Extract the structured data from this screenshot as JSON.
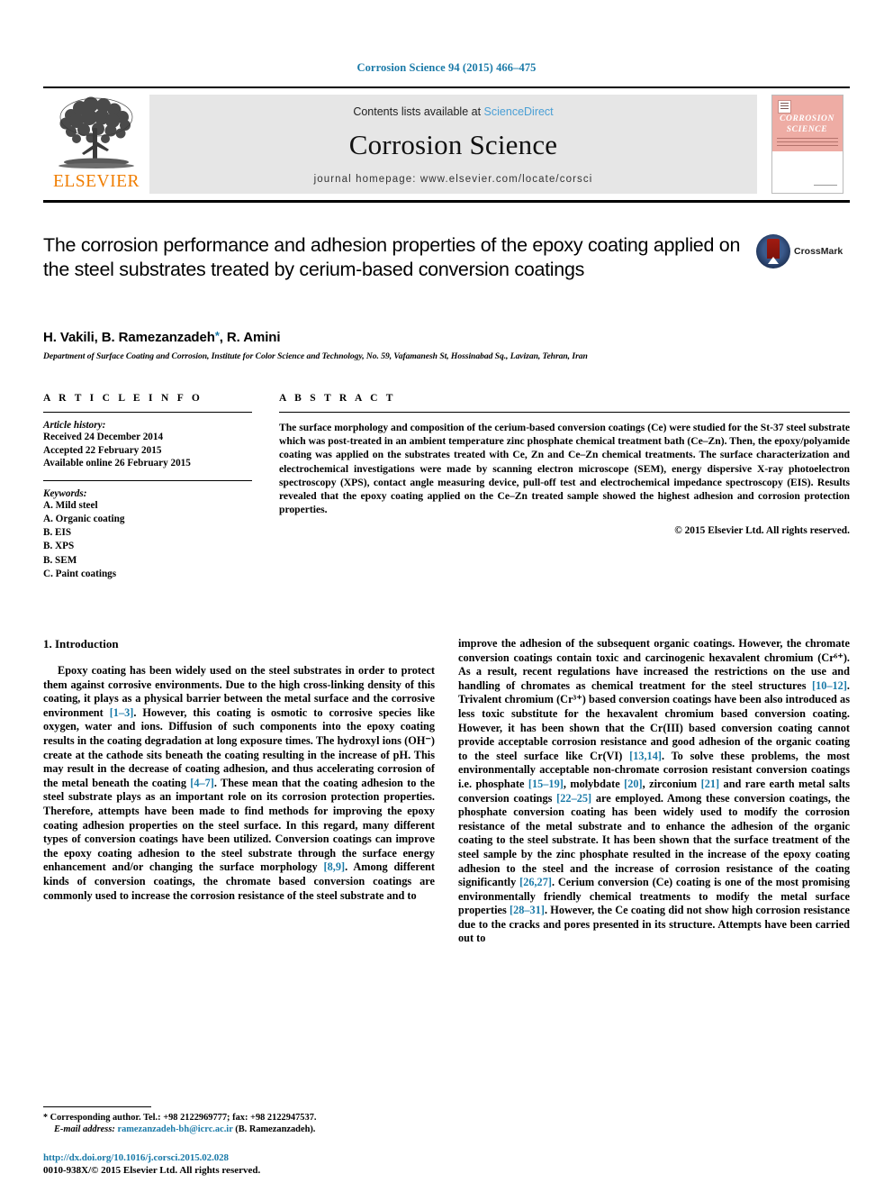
{
  "running_head": "Corrosion Science 94 (2015) 466–475",
  "masthead": {
    "publisher_name": "ELSEVIER",
    "contents_prefix": "Contents lists available at",
    "sciencedirect": "ScienceDirect",
    "journal_name": "Corrosion Science",
    "homepage": "journal homepage: www.elsevier.com/locate/corsci",
    "cover": {
      "line1": "CORROSION",
      "line2": "SCIENCE"
    }
  },
  "article": {
    "title": "The corrosion performance and adhesion properties of the epoxy coating applied on the steel substrates treated by cerium-based conversion coatings",
    "crossmark_label": "CrossMark",
    "authors_pre": "H. Vakili, B. Ramezanzadeh",
    "authors_star": "*",
    "authors_post": ", R. Amini",
    "affiliation": "Department of Surface Coating and Corrosion, Institute for Color Science and Technology, No. 59, Vafamanesh St, Hossinabad Sq., Lavizan, Tehran, Iran"
  },
  "article_info": {
    "heading": "A R T I C L E   I N F O",
    "history_label": "Article history:",
    "history": [
      "Received 24 December 2014",
      "Accepted 22 February 2015",
      "Available online 26 February 2015"
    ],
    "keywords_label": "Keywords:",
    "keywords": [
      "A. Mild steel",
      "A. Organic coating",
      "B. EIS",
      "B. XPS",
      "B. SEM",
      "C. Paint coatings"
    ]
  },
  "abstract": {
    "heading": "A B S T R A C T",
    "text": "The surface morphology and composition of the cerium-based conversion coatings (Ce) were studied for the St-37 steel substrate which was post-treated in an ambient temperature zinc phosphate chemical treatment bath (Ce–Zn). Then, the epoxy/polyamide coating was applied on the substrates treated with Ce, Zn and Ce–Zn chemical treatments. The surface characterization and electrochemical investigations were made by scanning electron microscope (SEM), energy dispersive X-ray photoelectron spectroscopy (XPS), contact angle measuring device, pull-off test and electrochemical impedance spectroscopy (EIS). Results revealed that the epoxy coating applied on the Ce–Zn treated sample showed the highest adhesion and corrosion protection properties.",
    "copyright": "© 2015 Elsevier Ltd. All rights reserved."
  },
  "body": {
    "section_heading": "1. Introduction",
    "left_segments": [
      {
        "t": "Epoxy coating has been widely used on the steel substrates in order to protect them against corrosive environments. Due to the high cross-linking density of this coating, it plays as a physical barrier between the metal surface and the corrosive environment ",
        "ref": false
      },
      {
        "t": "[1–3]",
        "ref": true
      },
      {
        "t": ". However, this coating is osmotic to corrosive species like oxygen, water and ions. Diffusion of such components into the epoxy coating results in the coating degradation at long exposure times. The hydroxyl ions (OH⁻) create at the cathode sits beneath the coating resulting in the increase of pH. This may result in the decrease of coating adhesion, and thus accelerating corrosion of the metal beneath the coating ",
        "ref": false
      },
      {
        "t": "[4–7]",
        "ref": true
      },
      {
        "t": ". These mean that the coating adhesion to the steel substrate plays as an important role on its corrosion protection properties. Therefore, attempts have been made to find methods for improving the epoxy coating adhesion properties on the steel surface. In this regard, many different types of conversion coatings have been utilized. Conversion coatings can improve the epoxy coating adhesion to the steel substrate through the surface energy enhancement and/or changing the surface morphology ",
        "ref": false
      },
      {
        "t": "[8,9]",
        "ref": true
      },
      {
        "t": ". Among different kinds of conversion coatings, the chromate based conversion coatings are commonly used to increase the corrosion resistance of the steel substrate and to",
        "ref": false
      }
    ],
    "right_segments": [
      {
        "t": "improve the adhesion of the subsequent organic coatings. However, the chromate conversion coatings contain toxic and carcinogenic hexavalent chromium (Cr⁶⁺). As a result, recent regulations have increased the restrictions on the use and handling of chromates as chemical treatment for the steel structures ",
        "ref": false
      },
      {
        "t": "[10–12]",
        "ref": true
      },
      {
        "t": ". Trivalent chromium (Cr³⁺) based conversion coatings have been also introduced as less toxic substitute for the hexavalent chromium based conversion coating. However, it has been shown that the Cr(III) based conversion coating cannot provide acceptable corrosion resistance and good adhesion of the organic coating to the steel surface like Cr(VI) ",
        "ref": false
      },
      {
        "t": "[13,14]",
        "ref": true
      },
      {
        "t": ". To solve these problems, the most environmentally acceptable non-chromate corrosion resistant conversion coatings i.e. phosphate ",
        "ref": false
      },
      {
        "t": "[15–19]",
        "ref": true
      },
      {
        "t": ", molybdate ",
        "ref": false
      },
      {
        "t": "[20]",
        "ref": true
      },
      {
        "t": ", zirconium ",
        "ref": false
      },
      {
        "t": "[21]",
        "ref": true
      },
      {
        "t": " and rare earth metal salts conversion coatings ",
        "ref": false
      },
      {
        "t": "[22–25]",
        "ref": true
      },
      {
        "t": " are employed. Among these conversion coatings, the phosphate conversion coating has been widely used to modify the corrosion resistance of the metal substrate and to enhance the adhesion of the organic coating to the steel substrate. It has been shown that the surface treatment of the steel sample by the zinc phosphate resulted in the increase of the epoxy coating adhesion to the steel and the increase of corrosion resistance of the coating significantly ",
        "ref": false
      },
      {
        "t": "[26,27]",
        "ref": true
      },
      {
        "t": ". Cerium conversion (Ce) coating is one of the most promising environmentally friendly chemical treatments to modify the metal surface properties ",
        "ref": false
      },
      {
        "t": "[28–31]",
        "ref": true
      },
      {
        "t": ". However, the Ce coating did not show high corrosion resistance due to the cracks and pores presented in its structure. Attempts have been carried out to",
        "ref": false
      }
    ]
  },
  "footnote": {
    "star": "*",
    "corresponding": "Corresponding author. Tel.: +98 2122969777; fax: +98 2122947537.",
    "email_label": "E-mail address:",
    "email": "ramezanzadeh-bh@icrc.ac.ir",
    "email_owner": "(B. Ramezanzadeh)."
  },
  "doi": {
    "url": "http://dx.doi.org/10.1016/j.corsci.2015.02.028",
    "issn_line": "0010-938X/© 2015 Elsevier Ltd. All rights reserved."
  },
  "colors": {
    "link": "#1a7aa8",
    "elsevier_orange": "#F07D00",
    "sciencedirect": "#4a9fd5",
    "band_gray": "#e6e6e6",
    "cover_pink": "#eeaca4"
  }
}
